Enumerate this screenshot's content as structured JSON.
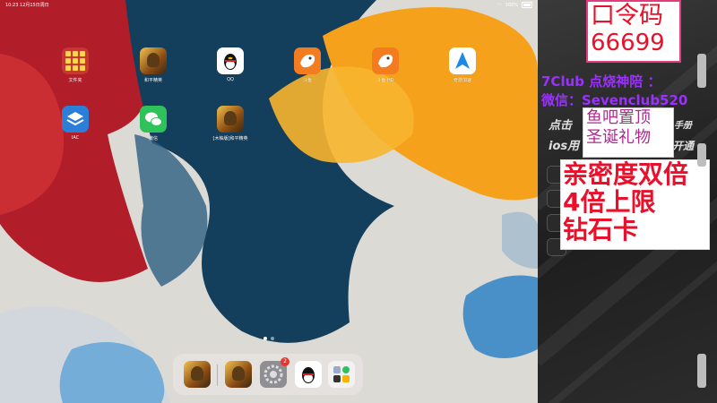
{
  "status_bar": {
    "time": "10:23",
    "date": "12月15日周日",
    "battery": "100%"
  },
  "home_apps": [
    {
      "label": "文件夹"
    },
    {
      "label": "和平精英"
    },
    {
      "label": "QQ"
    },
    {
      "label": "斗鱼"
    },
    {
      "label": "斗鱼 HD"
    },
    {
      "label": "奇游加速"
    },
    {
      "label": "IAC"
    },
    {
      "label": "微信"
    },
    {
      "label": "[木柚版]和平精英"
    }
  ],
  "dock": {
    "settings_badge": "2"
  },
  "promo": {
    "password_label": "口令码",
    "password_code": "66699",
    "club_line": "7Club 点烧神陪 ：",
    "wechat_line": "微信：Sevenclub520",
    "hidden_line1": "点击",
    "hidden_line1_end": "手册",
    "hidden_line2": "ios用",
    "hidden_line2_end": "开通",
    "yuba_line1": "鱼吧置顶",
    "yuba_line2": "圣诞礼物",
    "bonus_line1": "亲密度双倍",
    "bonus_line2": "4倍上限",
    "bonus_line3": "钻石卡"
  },
  "colors": {
    "accent_red": "#e8102a",
    "accent_violet": "#9b30ff",
    "wechat_green": "#2fc15a",
    "douyu_orange": "#f47c20"
  }
}
